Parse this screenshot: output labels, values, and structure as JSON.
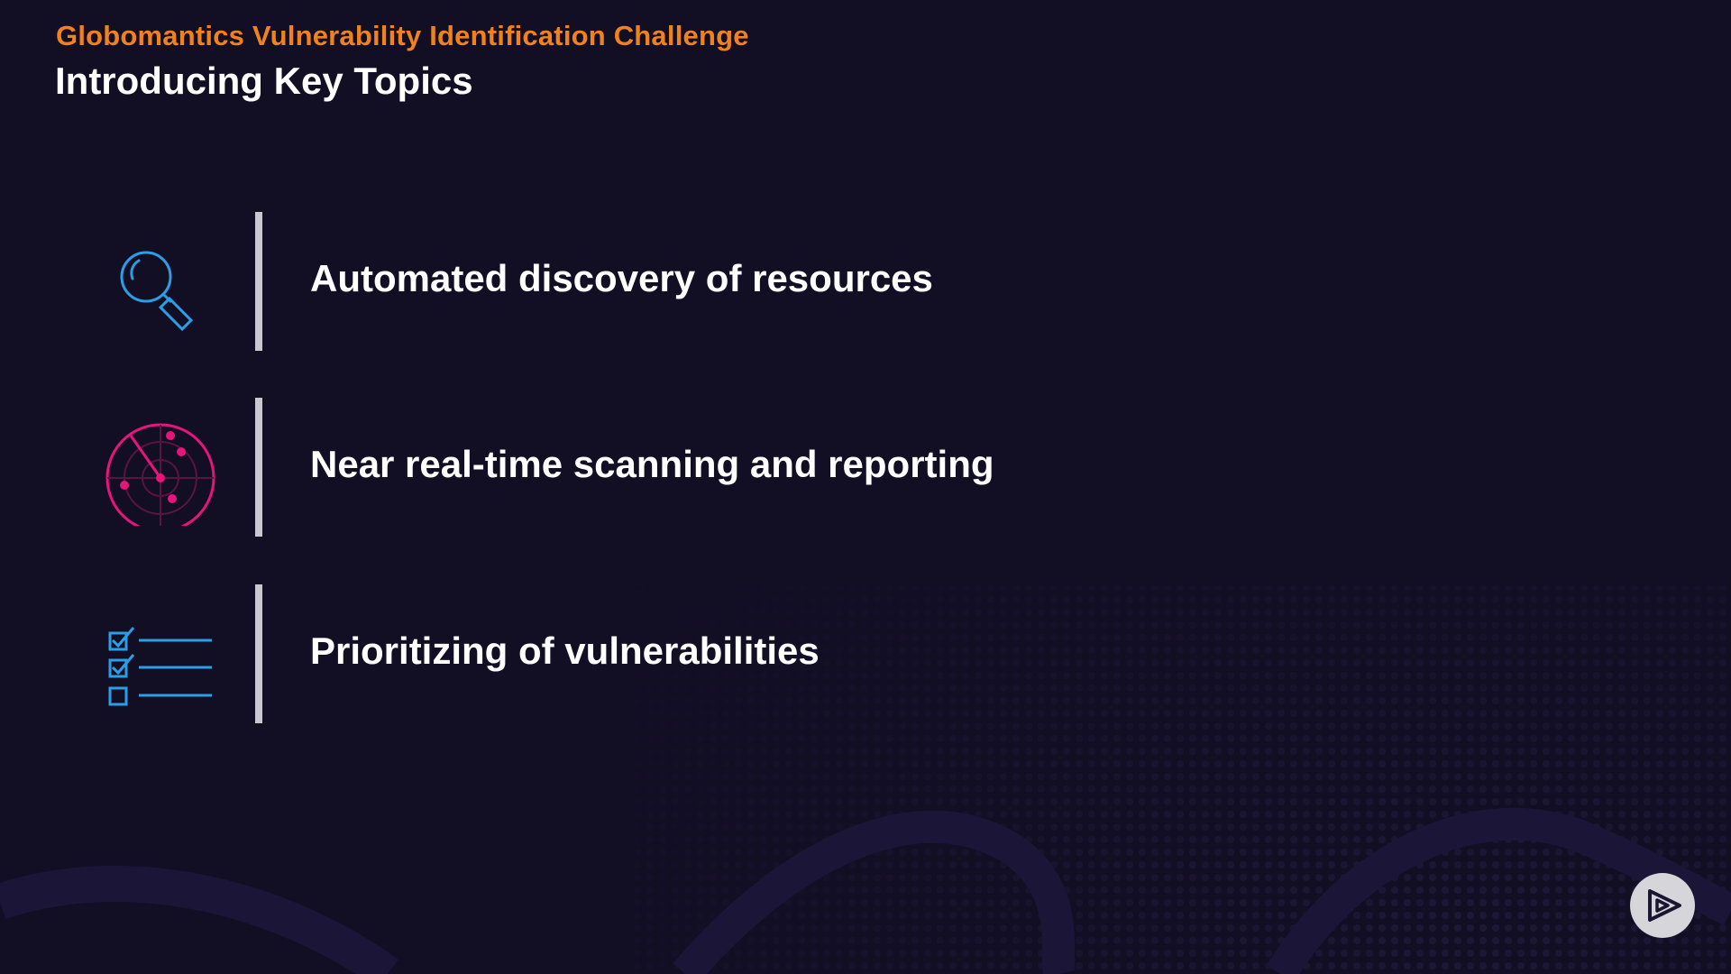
{
  "header": {
    "course_title": "Globomantics Vulnerability Identification Challenge",
    "page_title": "Introducing Key Topics"
  },
  "topics": [
    {
      "label": "Automated discovery of resources",
      "icon": "magnifying-glass-icon",
      "icon_color": "#2a9fe6"
    },
    {
      "label": "Near real-time scanning and reporting",
      "icon": "radar-icon",
      "icon_color": "#e8147a"
    },
    {
      "label": "Prioritizing of vulnerabilities",
      "icon": "checklist-icon",
      "icon_color": "#2a9fe6"
    }
  ],
  "controls": {
    "play_icon": "play-logo-icon"
  },
  "colors": {
    "background": "#120e24",
    "accent": "#f0821e",
    "text": "#ffffff",
    "divider": "#c9c7cf"
  }
}
